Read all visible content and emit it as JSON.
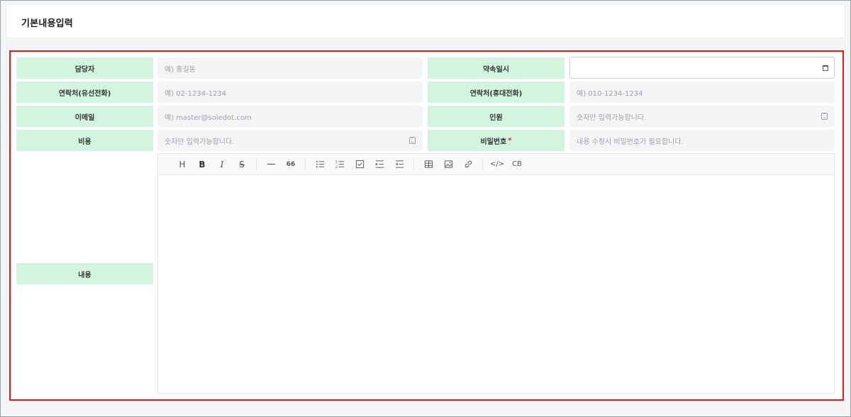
{
  "header": {
    "title": "기본내용입력"
  },
  "form": {
    "fields": [
      {
        "label": "담당자",
        "placeholder": "예) 홍길동"
      },
      {
        "label": "약속일시",
        "placeholder": ""
      },
      {
        "label": "연락처(유선전화)",
        "placeholder": "예) 02-1234-1234"
      },
      {
        "label": "연락처(휴대전화)",
        "placeholder": "예) 010-1234-1234"
      },
      {
        "label": "이메일",
        "placeholder": "예) master@soledot.com"
      },
      {
        "label": "인원",
        "placeholder": "숫자만 입력가능합니다."
      },
      {
        "label": "비용",
        "placeholder": "숫자만 입력가능합니다."
      },
      {
        "label": "비밀번호",
        "required_mark": "*",
        "placeholder": "내용 수정시 비밀번호가 필요합니다."
      },
      {
        "label": "내용"
      }
    ]
  },
  "editor": {
    "toolbar": [
      "heading-icon",
      "bold-icon",
      "italic-icon",
      "strike-icon",
      "hr-icon",
      "quote-icon",
      "bullet-list-icon",
      "ordered-list-icon",
      "task-list-icon",
      "indent-icon",
      "outdent-icon",
      "table-icon",
      "image-icon",
      "link-icon",
      "code-icon",
      "codeblock-icon"
    ],
    "heading_glyph": "H",
    "bold_glyph": "B",
    "italic_glyph": "I",
    "strike_glyph": "S",
    "quote_glyph": "66",
    "code_glyph": "</>",
    "codeblock_glyph": "CB",
    "content": ""
  }
}
